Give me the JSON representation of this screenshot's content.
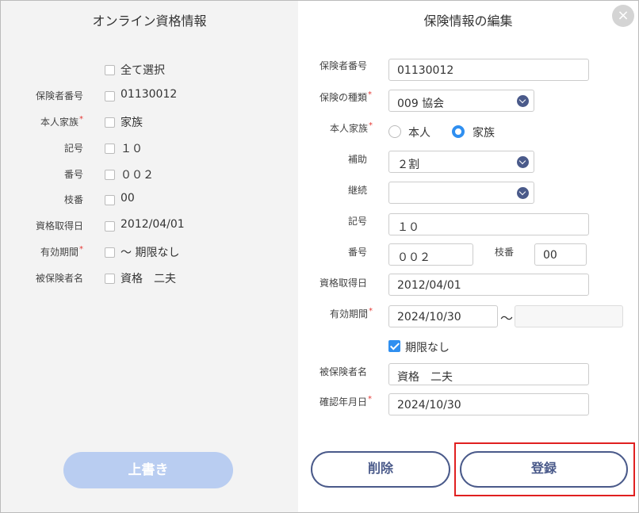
{
  "left_panel": {
    "title": "オンライン資格情報",
    "select_all_label": "全て選択",
    "rows": [
      {
        "label": "保険者番号",
        "value": "01130012",
        "required": false
      },
      {
        "label": "本人家族",
        "value": "家族",
        "required": true
      },
      {
        "label": "記号",
        "value": "１０",
        "required": false
      },
      {
        "label": "番号",
        "value": "００２",
        "required": false
      },
      {
        "label": "枝番",
        "value": "00",
        "required": false
      },
      {
        "label": "資格取得日",
        "value": "2012/04/01",
        "required": false
      },
      {
        "label": "有効期間",
        "value": "～ 期限なし",
        "required": true
      },
      {
        "label": "被保険者名",
        "value": "資格　二夫",
        "required": false
      }
    ],
    "overwrite_label": "上書き"
  },
  "right_panel": {
    "title": "保険情報の編集",
    "close_label": "×",
    "insurer_number": {
      "label": "保険者番号",
      "value": "01130012"
    },
    "insurance_type": {
      "label": "保険の種類",
      "value": "009 協会",
      "required_mark": "*"
    },
    "self_family": {
      "label": "本人家族",
      "required_mark": "*",
      "options": [
        "本人",
        "家族"
      ],
      "selected": "家族"
    },
    "assistance": {
      "label": "補助",
      "value": "２割"
    },
    "continuation": {
      "label": "継続",
      "value": ""
    },
    "symbol": {
      "label": "記号",
      "value": "１０"
    },
    "number": {
      "label": "番号",
      "value": "００２"
    },
    "branch": {
      "label": "枝番",
      "value": "00"
    },
    "acquisition_date": {
      "label": "資格取得日",
      "value": "2012/04/01"
    },
    "valid_period": {
      "label": "有効期間",
      "required_mark": "*",
      "from": "2024/10/30",
      "separator": "～",
      "to": ""
    },
    "no_expiry": {
      "label": "期限なし",
      "checked": true
    },
    "insured_name": {
      "label": "被保険者名",
      "value": "資格　二夫"
    },
    "confirmation_date": {
      "label": "確認年月日",
      "required_mark": "*",
      "value": "2024/10/30"
    },
    "delete_label": "削除",
    "register_label": "登録"
  },
  "colors": {
    "accent": "#2f8ff0",
    "navy": "#4a5a8a",
    "disabled_button": "#b9cdf1",
    "required": "#e53935",
    "highlight": "#e02020"
  }
}
